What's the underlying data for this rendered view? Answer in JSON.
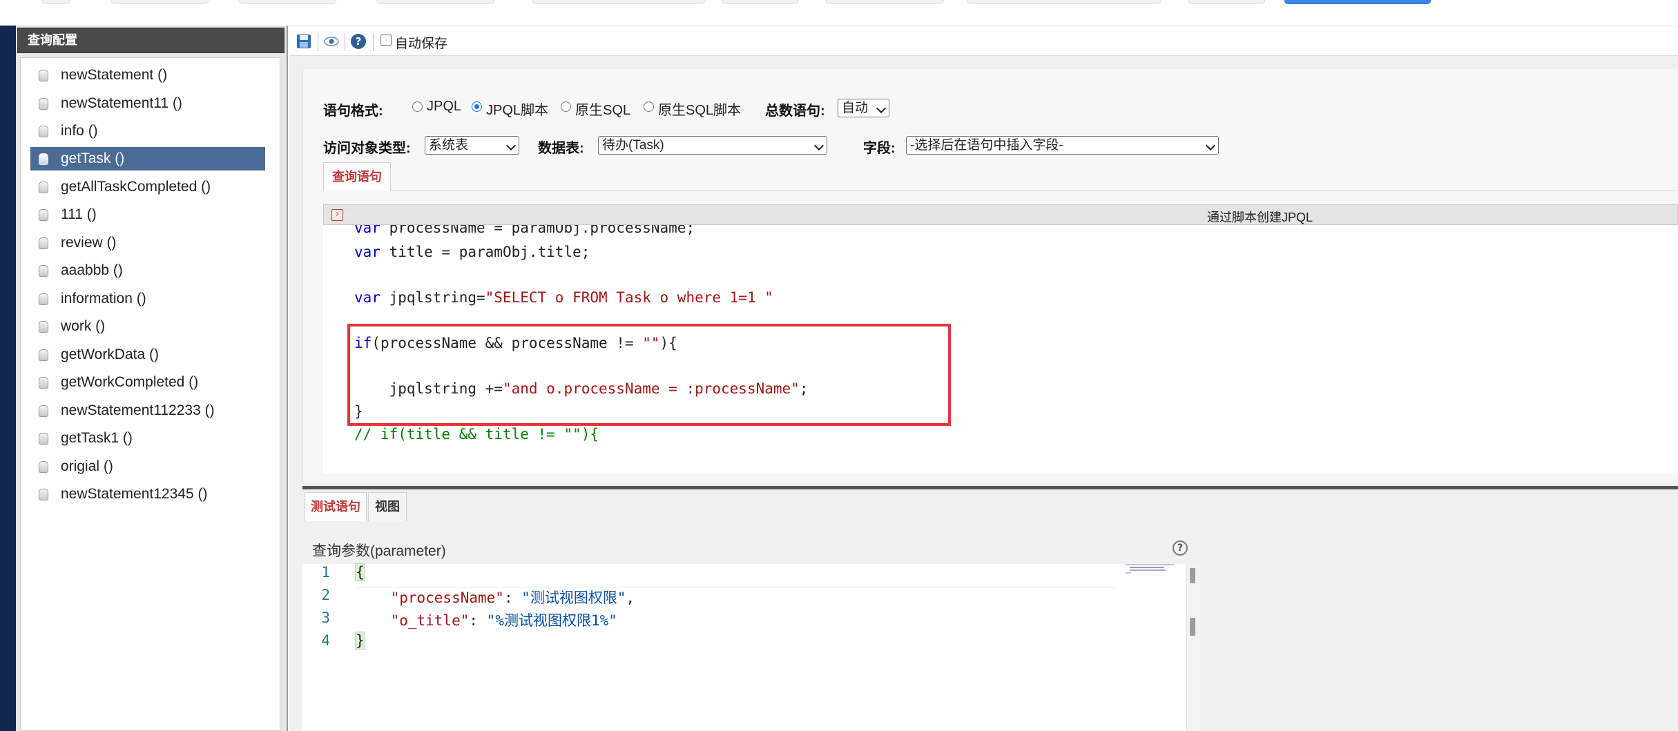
{
  "sidebar": {
    "title": "查询配置",
    "items": [
      {
        "label": "newStatement ()"
      },
      {
        "label": "newStatement11 ()"
      },
      {
        "label": "info ()"
      },
      {
        "label": "getTask ()",
        "selected": true
      },
      {
        "label": "getAllTaskCompleted ()"
      },
      {
        "label": "111 ()"
      },
      {
        "label": "review ()"
      },
      {
        "label": "aaabbb ()"
      },
      {
        "label": "information ()"
      },
      {
        "label": "work ()"
      },
      {
        "label": "getWorkData ()"
      },
      {
        "label": "getWorkCompleted ()"
      },
      {
        "label": "newStatement112233 ()"
      },
      {
        "label": "getTask1 ()"
      },
      {
        "label": "origial ()"
      },
      {
        "label": "newStatement12345 ()"
      }
    ]
  },
  "toolbar": {
    "save_icon": "save-icon",
    "preview_icon": "eye-icon",
    "help_icon": "help-icon",
    "autosave_label": "自动保存",
    "autosave_checked": false
  },
  "form": {
    "format_label": "语句格式:",
    "format_options": [
      "JPQL",
      "JPQL脚本",
      "原生SQL",
      "原生SQL脚本"
    ],
    "format_selected": "JPQL脚本",
    "count_label": "总数语句:",
    "count_value": "自动",
    "object_type_label": "访问对象类型:",
    "object_type_value": "系统表",
    "table_label": "数据表:",
    "table_value": "待办(Task)",
    "field_label": "字段:",
    "field_value": "-选择后在语句中插入字段-"
  },
  "tabs": {
    "query_tab": "查询语句",
    "test_tab": "测试语句",
    "view_tab": "视图"
  },
  "editor": {
    "header_title": "通过脚本创建JPQL",
    "lines": {
      "l1_kw": "var",
      "l1_rest": " processName = paramObj.processName;",
      "l2_kw": "var",
      "l2_rest": " title = paramObj.title;",
      "l3_kw": "var",
      "l3_mid": " jpqlstring=",
      "l3_str": "\"SELECT o FROM Task o where 1=1 \"",
      "l4_kw": "if",
      "l4_mid": "(processName && processName != ",
      "l4_str": "\"\"",
      "l4_end": "){",
      "l5_mid": "    jpqlstring +=",
      "l5_str": "\"and o.processName = :processName\"",
      "l5_end": ";",
      "l6": "}",
      "l7_comment": "// if(title && title != \"\"){"
    }
  },
  "params": {
    "title": "查询参数(parameter)",
    "line_numbers": [
      "1",
      "2",
      "3",
      "4"
    ],
    "open_brace": "{",
    "k1": "\"processName\"",
    "v1": "\"测试视图权限\"",
    "k2": "\"o_title\"",
    "v2": "\"%测试视图权限1%\"",
    "close_brace": "}"
  },
  "colors": {
    "sidebar_selected": "#4b6b97",
    "highlight_box": "#e5363a",
    "left_bar": "#10284d"
  }
}
